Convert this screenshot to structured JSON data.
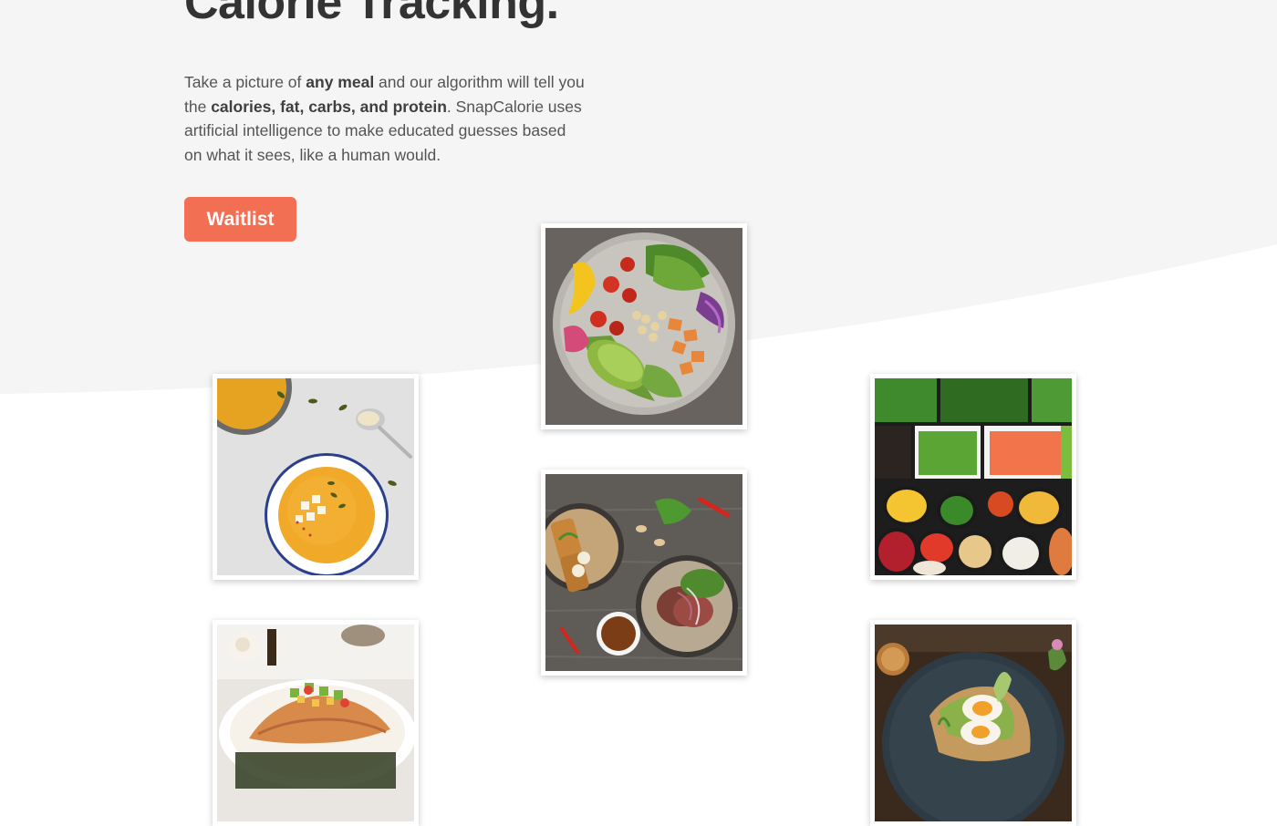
{
  "hero": {
    "title": "Calorie Tracking.",
    "description": {
      "part1": "Take a picture of ",
      "bold1": "any meal",
      "part2": " and our algorithm will tell you the ",
      "bold2": "calories, fat, carbs, and protein",
      "part3": ". SnapCalorie uses artificial intelligence to make educated guesses based on what it sees, like a human would."
    },
    "waitlist_label": "Waitlist"
  },
  "colors": {
    "accent": "#f26f54",
    "hero_background": "#f5f5f5",
    "title_text": "#333333",
    "body_text": "#545454"
  },
  "gallery": {
    "photos": [
      {
        "name": "veggie-buddha-bowl-photo"
      },
      {
        "name": "pumpkin-soup-photo"
      },
      {
        "name": "salad-bar-ingredients-photo"
      },
      {
        "name": "steak-and-fish-plates-photo"
      },
      {
        "name": "salmon-dish-photo"
      },
      {
        "name": "egg-avocado-toast-photo"
      }
    ]
  }
}
